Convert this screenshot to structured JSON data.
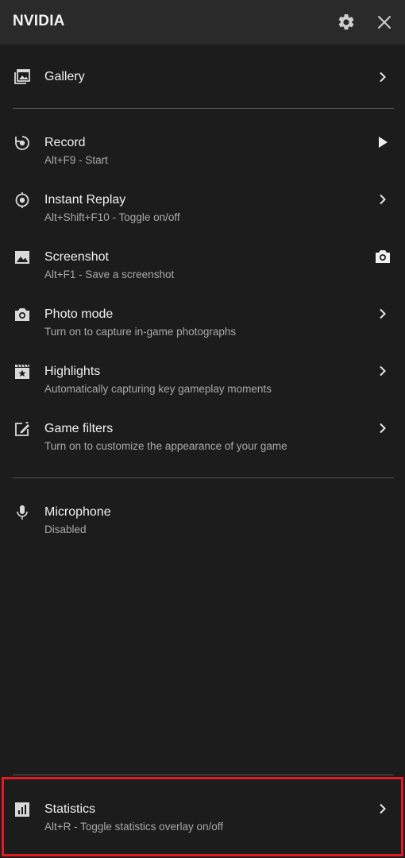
{
  "header": {
    "title": "NVIDIA",
    "settings_icon": "gear-icon",
    "close_icon": "close-icon"
  },
  "items": {
    "gallery": {
      "label": "Gallery",
      "icon": "gallery-icon"
    },
    "record": {
      "label": "Record",
      "sub": "Alt+F9 - Start",
      "icon": "record-icon",
      "action_icon": "play-icon"
    },
    "instant_replay": {
      "label": "Instant Replay",
      "sub": "Alt+Shift+F10 - Toggle on/off",
      "icon": "instant-replay-icon"
    },
    "screenshot": {
      "label": "Screenshot",
      "sub": "Alt+F1 - Save a screenshot",
      "icon": "image-icon",
      "action_icon": "camera-icon"
    },
    "photo_mode": {
      "label": "Photo mode",
      "sub": "Turn on to capture in-game photographs",
      "icon": "camera-icon"
    },
    "highlights": {
      "label": "Highlights",
      "sub": "Automatically capturing key gameplay moments",
      "icon": "highlights-icon"
    },
    "game_filters": {
      "label": "Game filters",
      "sub": "Turn on to customize the appearance of your game",
      "icon": "game-filters-icon"
    },
    "microphone": {
      "label": "Microphone",
      "sub": "Disabled",
      "icon": "microphone-icon"
    },
    "statistics": {
      "label": "Statistics",
      "sub": "Alt+R - Toggle statistics overlay on/off",
      "icon": "statistics-icon"
    }
  },
  "colors": {
    "background": "#1c1c1c",
    "header": "#2a2a2a",
    "text": "#f0f0f0",
    "subtext": "#a9a9a9",
    "divider": "#555555",
    "highlight": "#e01b24"
  }
}
